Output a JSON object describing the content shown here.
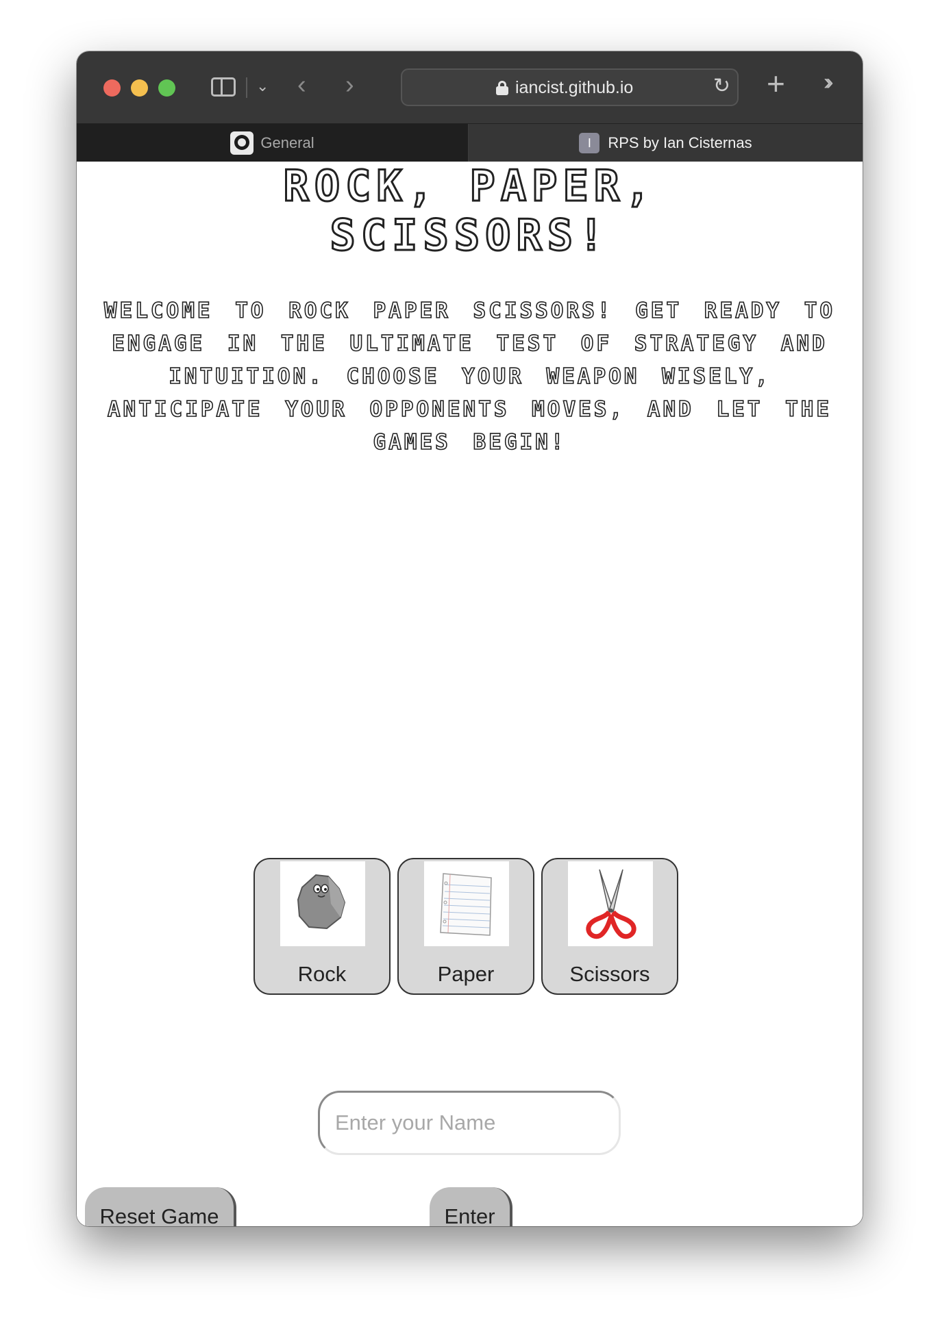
{
  "browser": {
    "url": "iancist.github.io",
    "tabs": [
      {
        "label": "General",
        "favicon": "github-icon",
        "active": false
      },
      {
        "label": "RPS by Ian Cisternas",
        "favicon": "letter-i-icon",
        "favicon_letter": "I",
        "active": true
      }
    ]
  },
  "page": {
    "title_line1": "Rock, Paper,",
    "title_line2": "Scissors!",
    "intro": "Welcome to Rock Paper Scissors! Get ready to engage in the ultimate test of strategy and intuition. Choose your weapon wisely, anticipate your opponents moves, and let the games begin!",
    "choices": [
      {
        "label": "Rock",
        "icon": "rock-icon"
      },
      {
        "label": "Paper",
        "icon": "paper-icon"
      },
      {
        "label": "Scissors",
        "icon": "scissors-icon"
      }
    ],
    "name_input": {
      "placeholder": "Enter your Name",
      "value": ""
    },
    "reset_label": "Reset Game",
    "enter_label": "Enter"
  },
  "colors": {
    "toolbar": "#373737",
    "choice_bg": "#d8d8d8",
    "button_bg": "#bdbdbd",
    "scissors_handle": "#e02626"
  }
}
